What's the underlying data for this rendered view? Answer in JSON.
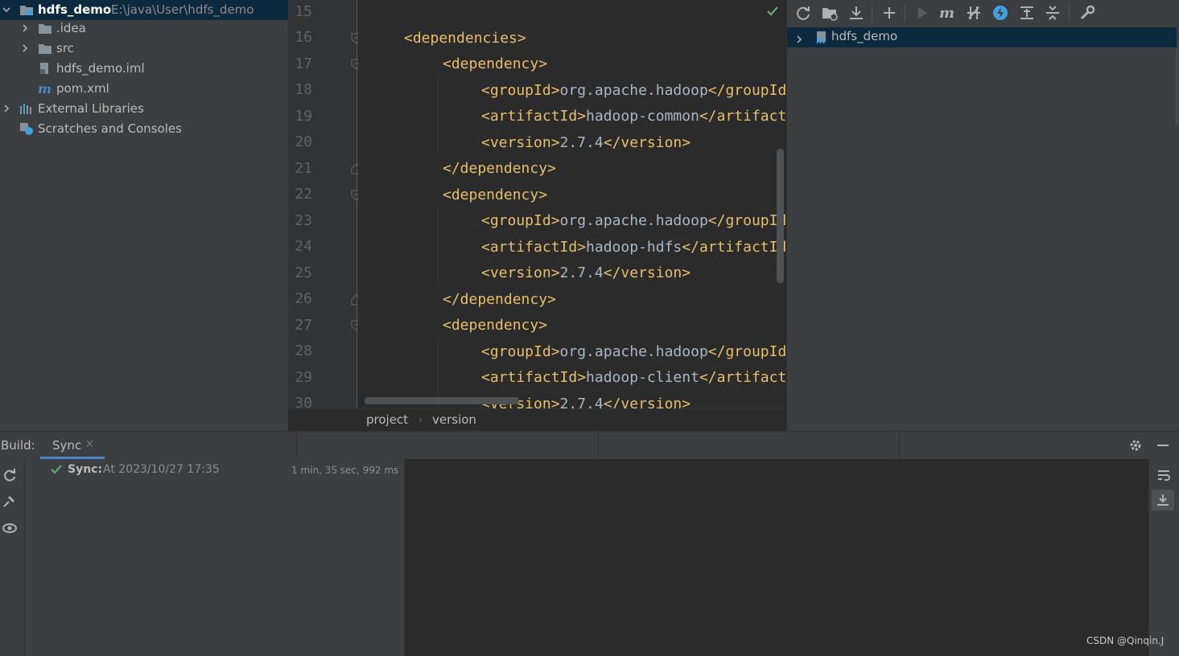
{
  "project_tree": {
    "root": {
      "name": "hdfs_demo",
      "path": "E:\\java\\User\\hdfs_demo"
    },
    "items": [
      {
        "label": ".idea"
      },
      {
        "label": "src"
      },
      {
        "label": "hdfs_demo.iml"
      },
      {
        "label": "pom.xml"
      },
      {
        "label": "External Libraries"
      },
      {
        "label": "Scratches and Consoles"
      }
    ]
  },
  "editor": {
    "line_numbers": [
      "15",
      "16",
      "17",
      "18",
      "19",
      "20",
      "21",
      "22",
      "23",
      "24",
      "25",
      "26",
      "27",
      "28",
      "29",
      "30"
    ],
    "lines": [
      {
        "tag1": "",
        "text": "",
        "tag2": ""
      },
      {
        "tag1": "<dependencies>",
        "text": "",
        "tag2": ""
      },
      {
        "tag1": "<dependency>",
        "text": "",
        "tag2": ""
      },
      {
        "tag1": "<groupId>",
        "text": "org.apache.hadoop",
        "tag2": "</groupId>"
      },
      {
        "tag1": "<artifactId>",
        "text": "hadoop-common",
        "tag2": "</artifactId>"
      },
      {
        "tag1": "<version>",
        "text": "2.7.4",
        "tag2": "</version>"
      },
      {
        "tag1": "</dependency>",
        "text": "",
        "tag2": ""
      },
      {
        "tag1": "<dependency>",
        "text": "",
        "tag2": ""
      },
      {
        "tag1": "<groupId>",
        "text": "org.apache.hadoop",
        "tag2": "</groupId>"
      },
      {
        "tag1": "<artifactId>",
        "text": "hadoop-hdfs",
        "tag2": "</artifactId>"
      },
      {
        "tag1": "<version>",
        "text": "2.7.4",
        "tag2": "</version>"
      },
      {
        "tag1": "</dependency>",
        "text": "",
        "tag2": ""
      },
      {
        "tag1": "<dependency>",
        "text": "",
        "tag2": ""
      },
      {
        "tag1": "<groupId>",
        "text": "org.apache.hadoop",
        "tag2": "</groupId>"
      },
      {
        "tag1": "<artifactId>",
        "text": "hadoop-client",
        "tag2": "</artifactId>"
      },
      {
        "tag1": "<version>",
        "text": "2.7.4",
        "tag2": "</version>"
      }
    ],
    "breadcrumb": [
      "project",
      "version"
    ]
  },
  "maven": {
    "project": "hdfs_demo"
  },
  "build": {
    "title": "Build:",
    "tab": "Sync",
    "tab_close": "×",
    "sync_label": "Sync:",
    "sync_time": "At 2023/10/27 17:35",
    "duration": "1 min, 35 sec, 992 ms"
  },
  "watermark": "CSDN @Qinqin.J",
  "colors": {
    "tag": "#e8bf6a",
    "text": "#a9b7c6",
    "selection": "#0d293e",
    "success": "#59a869",
    "accent": "#4a88c7"
  }
}
